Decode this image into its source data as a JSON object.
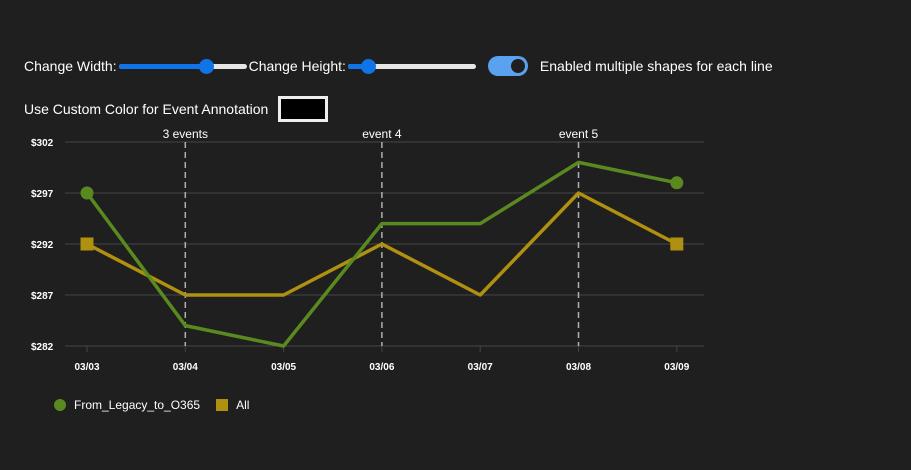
{
  "controls": {
    "width_label": "Change Width:",
    "width_value": 0.68,
    "height_label": "Change Height:",
    "height_value": 0.16,
    "multi_shapes_label": "Enabled multiple shapes for each line",
    "multi_shapes_on": true,
    "custom_color_label": "Use Custom Color for Event Annotation",
    "custom_color_value": "#000000"
  },
  "colors": {
    "background": "#1f1f1f",
    "grid": "#444444",
    "event_line": "#b0b0b0",
    "series1": "#5a8a1f",
    "series2": "#b09010",
    "accent": "#0f74e8"
  },
  "chart_data": {
    "type": "line",
    "x": [
      "03/03",
      "03/04",
      "03/05",
      "03/06",
      "03/07",
      "03/08",
      "03/09"
    ],
    "y_ticks": [
      "$302",
      "$297",
      "$292",
      "$287",
      "$282"
    ],
    "ylim": [
      282,
      302
    ],
    "grid": true,
    "legend_position": "bottom-left",
    "series": [
      {
        "name": "From_Legacy_to_O365",
        "marker": "circle",
        "values": [
          297,
          284,
          282,
          294,
          294,
          300,
          298
        ]
      },
      {
        "name": "All",
        "marker": "square",
        "values": [
          292,
          287,
          287,
          292,
          287,
          297,
          292
        ]
      }
    ],
    "events": [
      {
        "x_index": 1,
        "label": "3 events"
      },
      {
        "x_index": 3,
        "label": "event 4"
      },
      {
        "x_index": 5,
        "label": "event 5"
      }
    ]
  }
}
